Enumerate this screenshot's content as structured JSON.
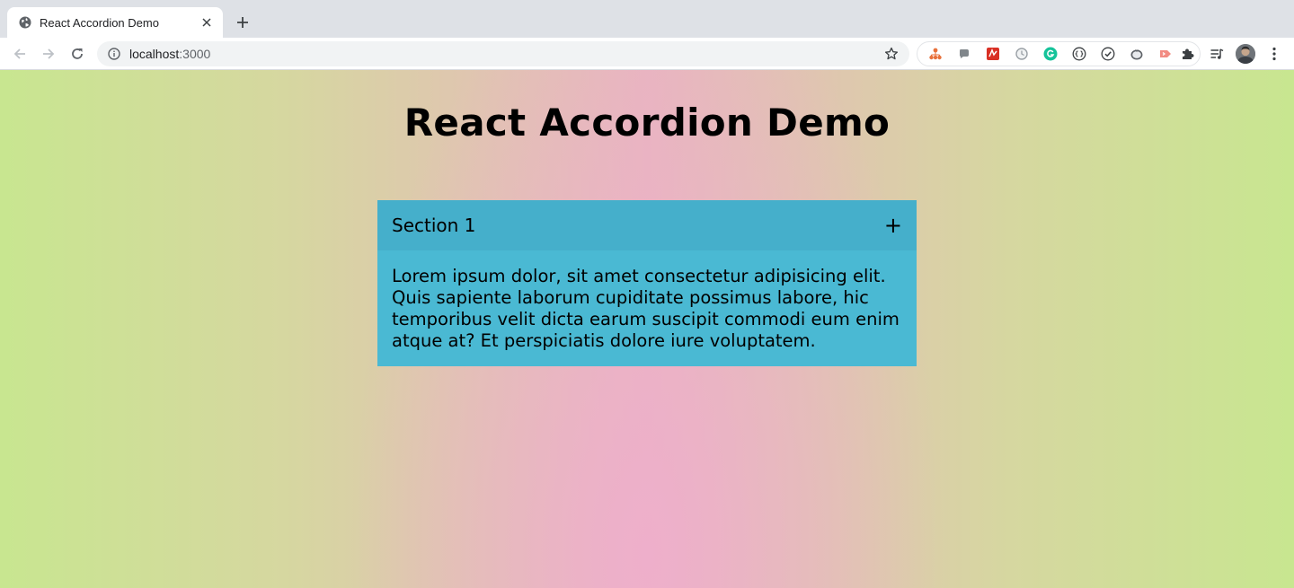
{
  "browser": {
    "tab": {
      "title": "React Accordion Demo"
    },
    "address": {
      "host": "localhost",
      "port": ":3000"
    },
    "extensions": [
      {
        "name": "org-chart-extension-icon",
        "color": "#e8713b"
      },
      {
        "name": "chat-bubble-extension-icon",
        "color": "#80868b"
      },
      {
        "name": "red-square-extension-icon",
        "color": "#d93025"
      },
      {
        "name": "clock-extension-icon",
        "color": "#9aa0a6"
      },
      {
        "name": "grammarly-extension-icon",
        "color": "#15c39a"
      },
      {
        "name": "code-braces-extension-icon",
        "color": "#3c4043"
      },
      {
        "name": "check-circle-extension-icon",
        "color": "#3c4043"
      },
      {
        "name": "tomato-extension-icon",
        "color": "#5f6368"
      },
      {
        "name": "arrow-tag-extension-icon",
        "color": "#f28b82"
      }
    ]
  },
  "page": {
    "title": "React Accordion Demo",
    "accordion": {
      "sections": [
        {
          "label": "Section 1",
          "toggle": "+",
          "content": "Lorem ipsum dolor, sit amet consectetur adipisicing elit. Quis sapiente laborum cupiditate possimus labore, hic temporibus velit dicta earum suscipit commodi eum enim atque at? Et perspiciatis dolore iure voluptatem."
        }
      ]
    }
  },
  "colors": {
    "accordion_header": "#45afcb",
    "accordion_content": "#4ab9d3",
    "background_green": "#c8e690",
    "background_pink": "#eeafcb"
  }
}
